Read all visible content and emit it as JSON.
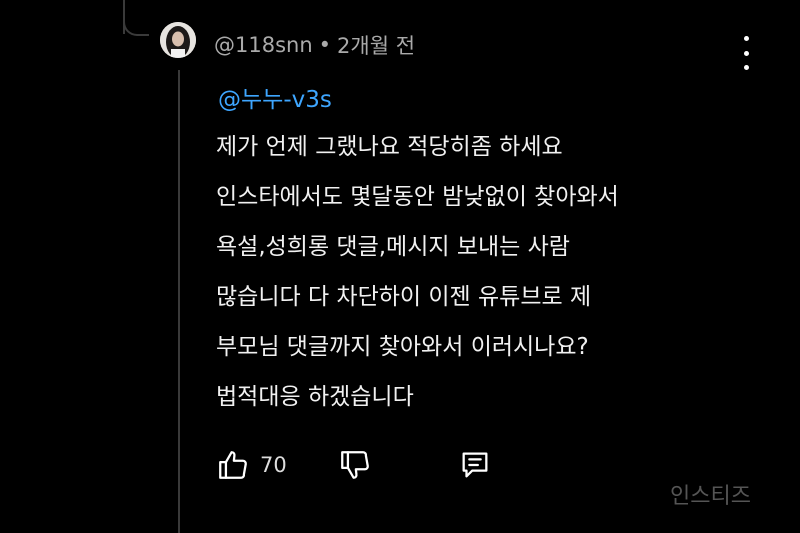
{
  "comment": {
    "author": "@118snn",
    "separator": "•",
    "time": "2개월 전",
    "mention": "@누누-v3s",
    "lines": [
      "제가 언제 그랬나요 적당히좀 하세요",
      "인스타에서도 몇달동안 밤낮없이 찾아와서",
      "욕설,성희롱 댓글,메시지 보내는 사람",
      "많습니다 다 차단하이 이젠 유튜브로 제",
      "부모님 댓글까지 찾아와서 이러시나요?",
      "법적대응 하겠습니다"
    ],
    "like_count": "70"
  },
  "watermark": "인스티즈",
  "icons": {
    "like": "thumbs-up-icon",
    "dislike": "thumbs-down-icon",
    "reply": "reply-comment-icon",
    "more": "more-vertical-icon"
  },
  "colors": {
    "background": "#000000",
    "mention": "#3ea6ff",
    "meta": "#aaaaaa",
    "text": "#f1f1f1"
  }
}
